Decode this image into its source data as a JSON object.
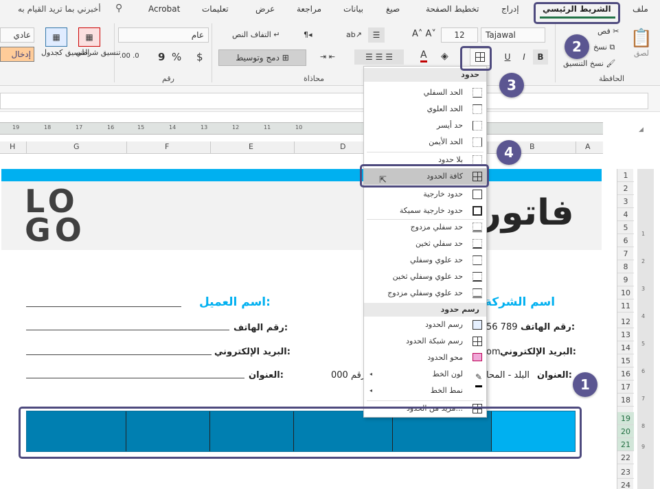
{
  "tabs": [
    "ملف",
    "الشريط الرئيسي",
    "إدراج",
    "تخطيط الصفحة",
    "صيغ",
    "بيانات",
    "مراجعة",
    "عرض",
    "تعليمات",
    "Acrobat"
  ],
  "tellme": "أخبرني بما تريد القيام به",
  "ribbon": {
    "paste": "لصق",
    "cut": "قص",
    "copy": "نسخ",
    "format_painter": "نسخ التنسيق",
    "clipboard": "الحافظة",
    "font_name": "Tajawal",
    "font_size": "12",
    "bold": "B",
    "italic": "I",
    "underline": "U",
    "wrap_text": "التفاف النص",
    "merge_center": "دمج وتوسيط",
    "alignment": "محاذاة",
    "number_format": "عام",
    "number": "رقم",
    "currency": "$",
    "percent": "%",
    "comma": "9",
    "conditional": "تنسيق شرطي",
    "format_table": "التنسيق كجدول",
    "style_normal": "عادي",
    "style_input": "إدخال"
  },
  "sheet": {
    "ruler_ticks": [
      "19",
      "18",
      "17",
      "16",
      "15",
      "14",
      "13",
      "12",
      "11",
      "10"
    ],
    "columns": [
      "H",
      "G",
      "F",
      "E",
      "D",
      "B",
      "A"
    ],
    "rows": [
      "1",
      "2",
      "3",
      "4",
      "5",
      "6",
      "7",
      "8",
      "9",
      "10",
      "11",
      "12",
      "13",
      "14",
      "15",
      "16",
      "17",
      "18",
      "19",
      "20",
      "21",
      "22",
      "23",
      "24"
    ],
    "vruler": [
      "1",
      "2",
      "3",
      "4",
      "5",
      "6",
      "7",
      "8",
      "9"
    ]
  },
  "invoice": {
    "logo_top": "LO",
    "logo_bottom": "GO",
    "title": "فاتور",
    "company_header": "اسم الشركة",
    "customer_header": "اسم العميل:",
    "phone_label": "رقم الهاتف:",
    "phone_value": "56 789",
    "email_label": "البريد الإلكتروني:",
    "email_value": "om",
    "address_label": "العنوان:",
    "address_value": "البلد - المحا",
    "address_value2": "رقم 000"
  },
  "menu": {
    "header_borders": "حدود",
    "items": [
      "الحد السفلي",
      "الحد العلوي",
      "حد أيسر",
      "الحد الأيمن",
      "بلا حدود",
      "كافة الحدود",
      "حدود خارجية",
      "حدود خارجية سميكة",
      "حد سفلي مزدوج",
      "حد سفلي ثخين",
      "حد علوي وسفلي",
      "حد علوي وسفلي ثخين",
      "حد علوي وسفلي مزدوج"
    ],
    "header_draw": "رسم حدود",
    "draw_items": [
      "رسم الحدود",
      "رسم شبكة الحدود",
      "محو الحدود",
      "لون الخط",
      "نمط الخط",
      "مزيد من الحدود..."
    ]
  },
  "badges": [
    "1",
    "2",
    "3",
    "4"
  ]
}
